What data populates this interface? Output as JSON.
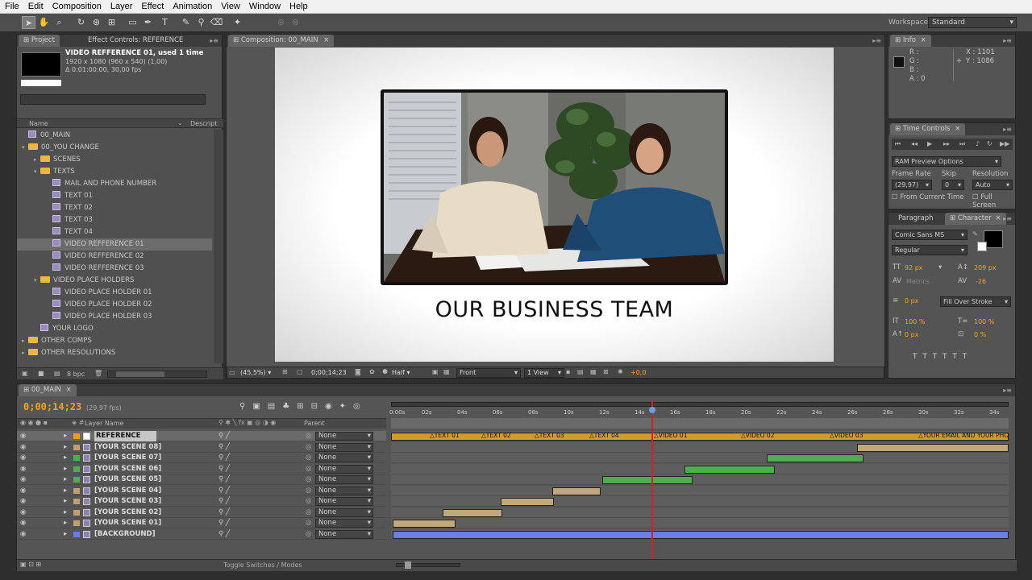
{
  "menu": [
    "File",
    "Edit",
    "Composition",
    "Layer",
    "Effect",
    "Animation",
    "View",
    "Window",
    "Help"
  ],
  "workspace": {
    "label": "Workspace:",
    "value": "Standard"
  },
  "project": {
    "tabs": [
      "Project",
      "Effect Controls: REFERENCE"
    ],
    "item_name": "VIDEO REFFERENCE 01",
    "item_used": ", used 1 time",
    "item_size": "1920 x 1080  (960 x 540) (1,00)",
    "item_duration": "Δ 0:01:00:00, 30,00 fps",
    "col_name": "Name",
    "col_desc": "Descript",
    "items": [
      {
        "label": "00_MAIN",
        "type": "comp",
        "indent": 0
      },
      {
        "label": "00_YOU CHANGE",
        "type": "folder",
        "indent": 0,
        "open": true
      },
      {
        "label": "SCENES",
        "type": "folder",
        "indent": 1,
        "open": false
      },
      {
        "label": "TEXTS",
        "type": "folder",
        "indent": 1,
        "open": true
      },
      {
        "label": "MAIL AND PHONE NUMBER",
        "type": "comp",
        "indent": 2
      },
      {
        "label": "TEXT 01",
        "type": "comp",
        "indent": 2
      },
      {
        "label": "TEXT 02",
        "type": "comp",
        "indent": 2
      },
      {
        "label": "TEXT 03",
        "type": "comp",
        "indent": 2
      },
      {
        "label": "TEXT 04",
        "type": "comp",
        "indent": 2
      },
      {
        "label": "VIDEO REFFERENCE 01",
        "type": "comp",
        "indent": 2,
        "selected": true
      },
      {
        "label": "VIDEO REFFERENCE 02",
        "type": "comp",
        "indent": 2
      },
      {
        "label": "VIDEO REFFERENCE 03",
        "type": "comp",
        "indent": 2
      },
      {
        "label": "VIDEO PLACE HOLDERS",
        "type": "folder",
        "indent": 1,
        "open": true
      },
      {
        "label": "VIDEO PLACE HOLDER 01",
        "type": "comp",
        "indent": 2
      },
      {
        "label": "VIDEO PLACE HOLDER 02",
        "type": "comp",
        "indent": 2
      },
      {
        "label": "VIDEO PLACE HOLDER 03",
        "type": "comp",
        "indent": 2
      },
      {
        "label": "YOUR LOGO",
        "type": "comp",
        "indent": 1
      },
      {
        "label": "OTHER COMPS",
        "type": "folder",
        "indent": 0,
        "open": false
      },
      {
        "label": "OTHER RESOLUTIONS",
        "type": "folder",
        "indent": 0,
        "open": false
      }
    ],
    "bpc": "8 bpc"
  },
  "composition": {
    "tab": "Composition: 00_MAIN",
    "scene_title": "OUR BUSINESS TEAM",
    "zoom": "(45,5%)",
    "timecode": "0;00;14;23",
    "resolution": "Half",
    "view": "Front",
    "views": "1 View",
    "offset": "+0,0"
  },
  "info": {
    "tab": "Info",
    "r": "R :",
    "g": "G :",
    "b": "B :",
    "a": "A : 0",
    "x": "X : 1101",
    "y": "Y : 1086"
  },
  "time_controls": {
    "tab": "Time Controls",
    "ram": "RAM Preview Options",
    "frame_rate_label": "Frame Rate",
    "skip_label": "Skip",
    "resolution_label": "Resolution",
    "frame_rate": "(29,97)",
    "skip": "0",
    "resolution": "Auto",
    "from_current": "From Current Time",
    "full_screen": "Full Screen"
  },
  "character": {
    "tabs": [
      "Paragraph",
      "Character"
    ],
    "font": "Comic Sans MS",
    "style": "Regular",
    "size": "92 px",
    "leading": "209 px",
    "kerning": "Metrics",
    "tracking": "-26",
    "stroke": "0 px",
    "stroke_mode": "Fill Over Stroke",
    "vscale": "100 %",
    "hscale": "100 %",
    "baseline": "0 px",
    "tsume": "0 %"
  },
  "timeline": {
    "tab": "00_MAIN",
    "timecode": "0;00;14;23",
    "fps": "(29,97 fps)",
    "col_layer": "Layer Name",
    "col_parent": "Parent",
    "ticks": [
      "0:00s",
      "02s",
      "04s",
      "06s",
      "08s",
      "10s",
      "12s",
      "14s",
      "16s",
      "18s",
      "20s",
      "22s",
      "24s",
      "26s",
      "28s",
      "30s",
      "32s",
      "34s"
    ],
    "markers": [
      "TEXT 01",
      "TEXT 02",
      "TEXT 03",
      "TEXT 04",
      "VIDEO 01",
      "VIDEO 02",
      "VIDEO 03",
      "YOUR EMAIL AND YOUR PHO"
    ],
    "layers": [
      {
        "name": "REFERENCE",
        "label_color": "#e8a020",
        "parent": "None",
        "selected": true
      },
      {
        "name": "[YOUR SCENE 08]",
        "label_color": "#c0a070",
        "parent": "None"
      },
      {
        "name": "[YOUR SCENE 07]",
        "label_color": "#4cae4c",
        "parent": "None"
      },
      {
        "name": "[YOUR SCENE 06]",
        "label_color": "#4cae4c",
        "parent": "None"
      },
      {
        "name": "[YOUR SCENE 05]",
        "label_color": "#4cae4c",
        "parent": "None"
      },
      {
        "name": "[YOUR SCENE 04]",
        "label_color": "#c0a070",
        "parent": "None"
      },
      {
        "name": "[YOUR SCENE 03]",
        "label_color": "#c0a070",
        "parent": "None"
      },
      {
        "name": "[YOUR SCENE 02]",
        "label_color": "#c0a070",
        "parent": "None"
      },
      {
        "name": "[YOUR SCENE 01]",
        "label_color": "#c0a070",
        "parent": "None"
      },
      {
        "name": "[BACKGROUND]",
        "label_color": "#6a7ee8",
        "parent": "None"
      }
    ],
    "toggle": "Toggle Switches / Modes"
  }
}
